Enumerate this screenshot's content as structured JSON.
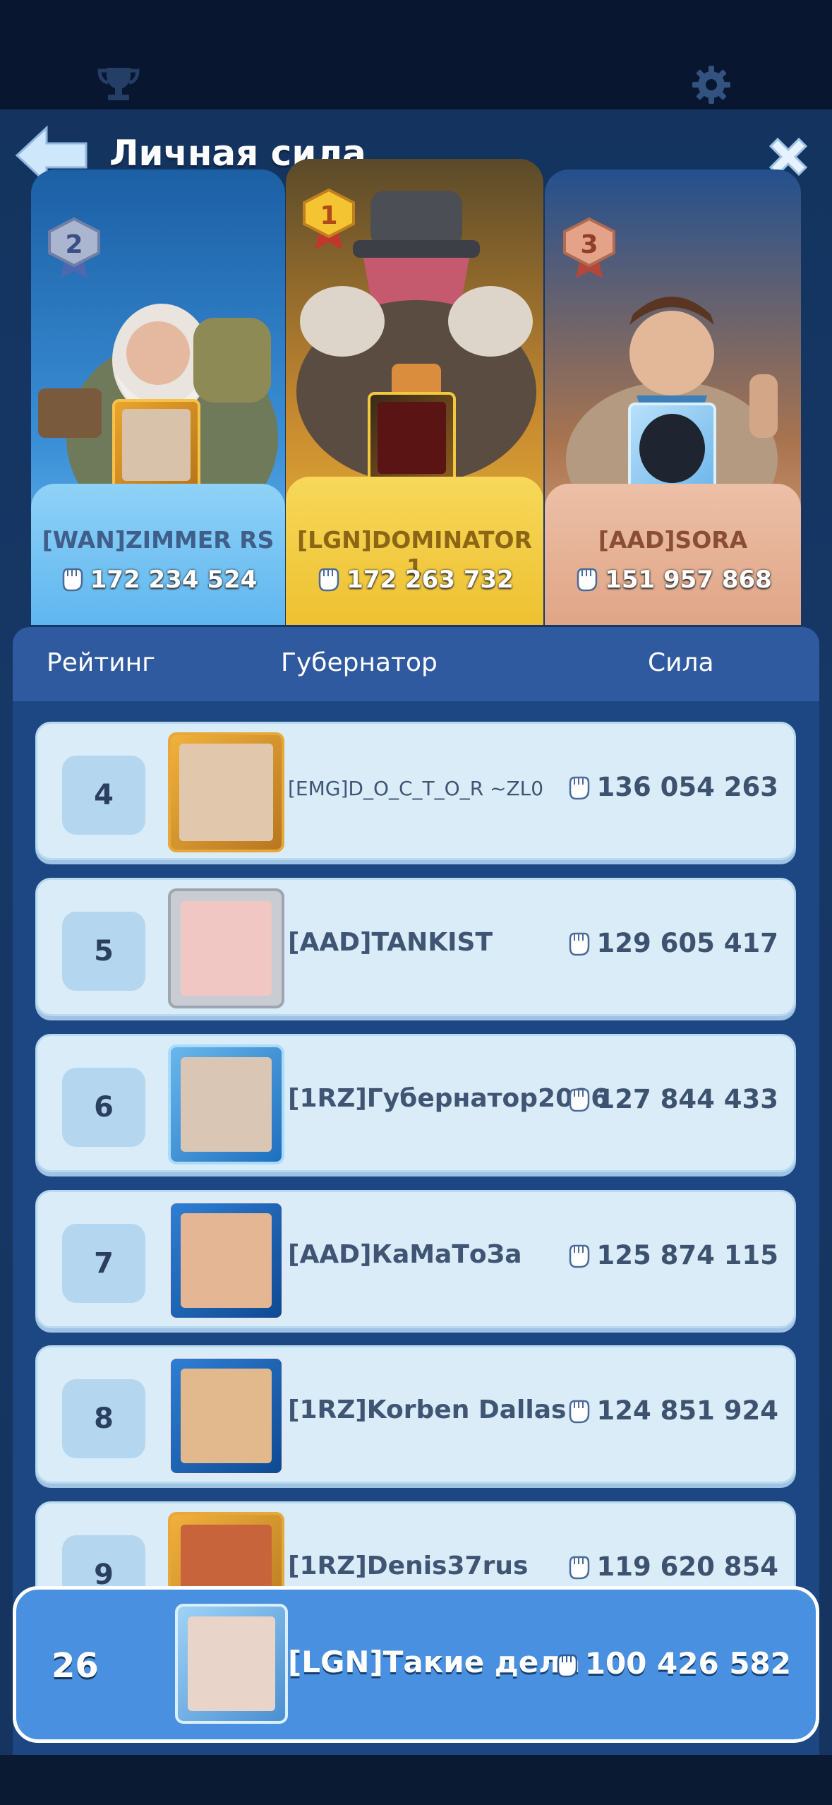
{
  "screen": {
    "title": "Личная сила"
  },
  "podium": [
    {
      "place": "2",
      "name": "[WAN]ZIMMER RS",
      "power": "172 234 524",
      "color": "#8fd3f7"
    },
    {
      "place": "1",
      "name": "[LGN]DOMINATOR 1",
      "power": "172 263 732",
      "color": "#f3c83a"
    },
    {
      "place": "3",
      "name": "[AAD]SORA",
      "power": "151 957 868",
      "color": "#e9b79e"
    }
  ],
  "table_header": {
    "rank": "Рейтинг",
    "governor": "Губернатор",
    "power": "Сила"
  },
  "rows": [
    {
      "rank": "4",
      "name": "[EMG]D_O_C_T_O_R ~ZL0",
      "power": "136 054 263"
    },
    {
      "rank": "5",
      "name": "[AAD]TANKIST",
      "power": "129 605 417"
    },
    {
      "rank": "6",
      "name": "[1RZ]Губернатор2026",
      "power": "127 844 433"
    },
    {
      "rank": "7",
      "name": "[AAD]КаМаТоЗа",
      "power": "125 874 115"
    },
    {
      "rank": "8",
      "name": "[1RZ]Korben Dallas",
      "power": "124 851 924"
    },
    {
      "rank": "9",
      "name": "[1RZ]Denis37rus",
      "power": "119 620 854"
    }
  ],
  "me": {
    "rank": "26",
    "name": "[LGN]Такие дела",
    "power": "100 426 582"
  },
  "icons": [
    "trophy-icon",
    "gear-icon",
    "back-arrow-icon",
    "close-icon",
    "fist-icon"
  ]
}
